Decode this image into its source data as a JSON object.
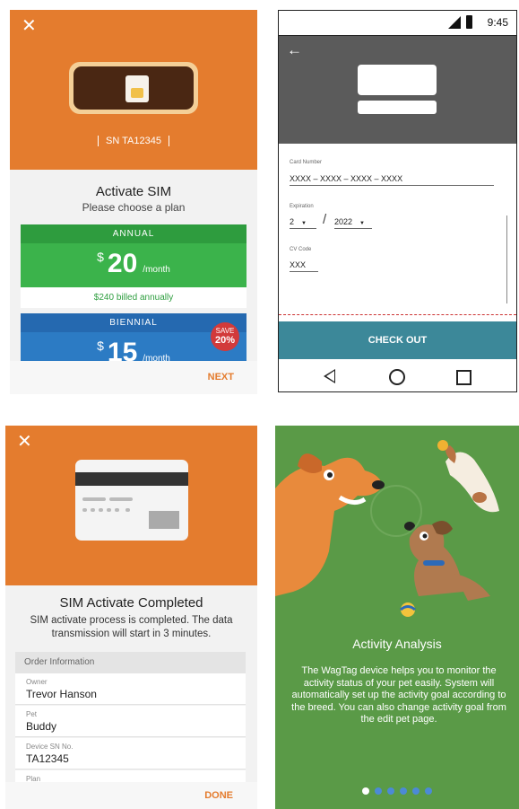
{
  "screen_activate": {
    "close_label": "✕",
    "serial": "SN TA12345",
    "title": "Activate SIM",
    "subtitle": "Please choose a plan",
    "annual": {
      "header": "ANNUAL",
      "currency": "$",
      "price": "20",
      "period": "/month",
      "billed": "$240 billed annually",
      "color": "#3bb34b"
    },
    "biennial": {
      "header": "BIENNIAL",
      "currency": "$",
      "price": "15",
      "period": "/month",
      "save_line1": "SAVE",
      "save_line2": "20%",
      "color": "#2c7bc4"
    },
    "next_label": "NEXT"
  },
  "screen_checkout": {
    "status_time": "9:45",
    "back_icon": "back-arrow-icon",
    "card_number_label": "Card Number",
    "card_number_value": "XXXX – XXXX – XXXX – XXXX",
    "expiration_label": "Expiration",
    "expiration_month": "2",
    "expiration_year": "2022",
    "cv_code_label": "CV Code",
    "cv_code_value": "XXX",
    "checkout_label": "CHECK OUT",
    "accent": "#3c8899"
  },
  "screen_completed": {
    "close_label": "✕",
    "title": "SIM Activate Completed",
    "description": "SIM activate process is completed. The data transmission will start in 3 minutes.",
    "order_header": "Order Information",
    "fields": [
      {
        "label": "Owner",
        "value": "Trevor Hanson"
      },
      {
        "label": "Pet",
        "value": "Buddy"
      },
      {
        "label": "Device SN No.",
        "value": "TA12345"
      },
      {
        "label": "Plan",
        "value": ""
      }
    ],
    "done_label": "DONE"
  },
  "screen_onboarding": {
    "title": "Activity Analysis",
    "description": "The WagTag device helps you to monitor the activity status of your pet easily. System will automatically set up the activity goal according to the breed. You can also change activity goal from the edit pet page.",
    "page_count": 6,
    "active_page": 1,
    "background": "#5a9a47"
  },
  "colors": {
    "orange": "#e47c2e",
    "green": "#3bb34b",
    "blue": "#2c7bc4",
    "red_badge": "#d23a3a"
  }
}
